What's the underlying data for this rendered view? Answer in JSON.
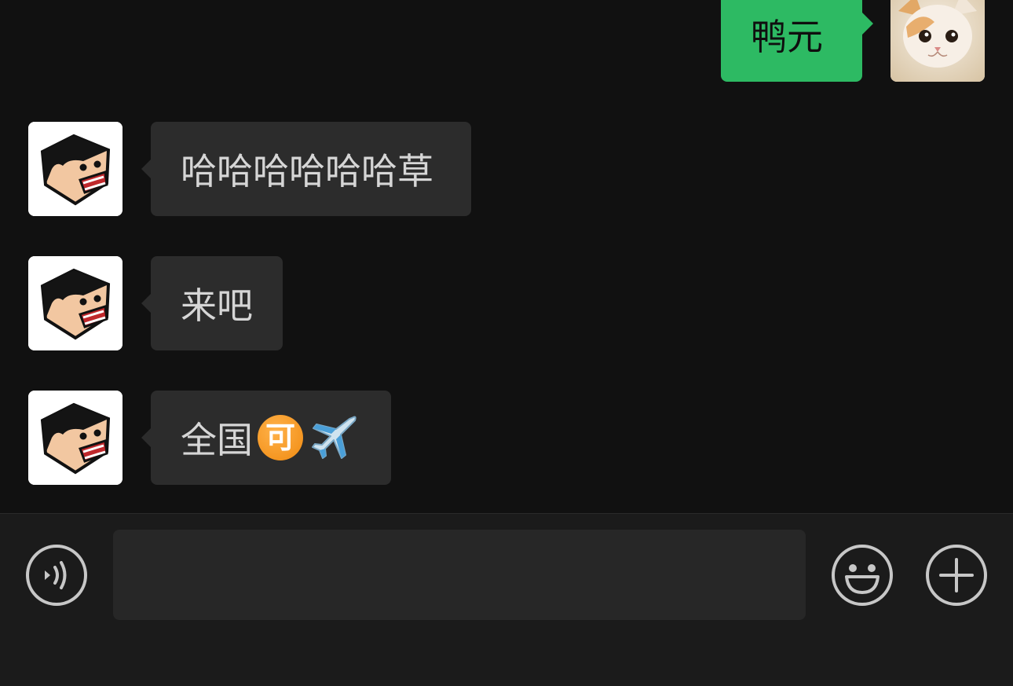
{
  "messages": [
    {
      "direction": "outgoing",
      "text": "鸭元",
      "avatar": "cat-photo-avatar"
    },
    {
      "direction": "incoming",
      "text": "哈哈哈哈哈哈草",
      "avatar": "cartoon-face-avatar"
    },
    {
      "direction": "incoming",
      "text": "来吧",
      "avatar": "cartoon-face-avatar"
    },
    {
      "direction": "incoming",
      "text": "全国",
      "emoji_text": "可",
      "emojis": [
        "circled-ke-emoji",
        "airplane-emoji"
      ],
      "avatar": "cartoon-face-avatar"
    }
  ],
  "input_bar": {
    "placeholder": "",
    "voice_icon": "voice-icon",
    "emoji_icon": "smiley-icon",
    "plus_icon": "plus-icon"
  },
  "colors": {
    "background": "#111111",
    "incoming_bubble": "#2c2c2c",
    "outgoing_bubble": "#2dba63",
    "input_bar": "#1b1b1b"
  }
}
